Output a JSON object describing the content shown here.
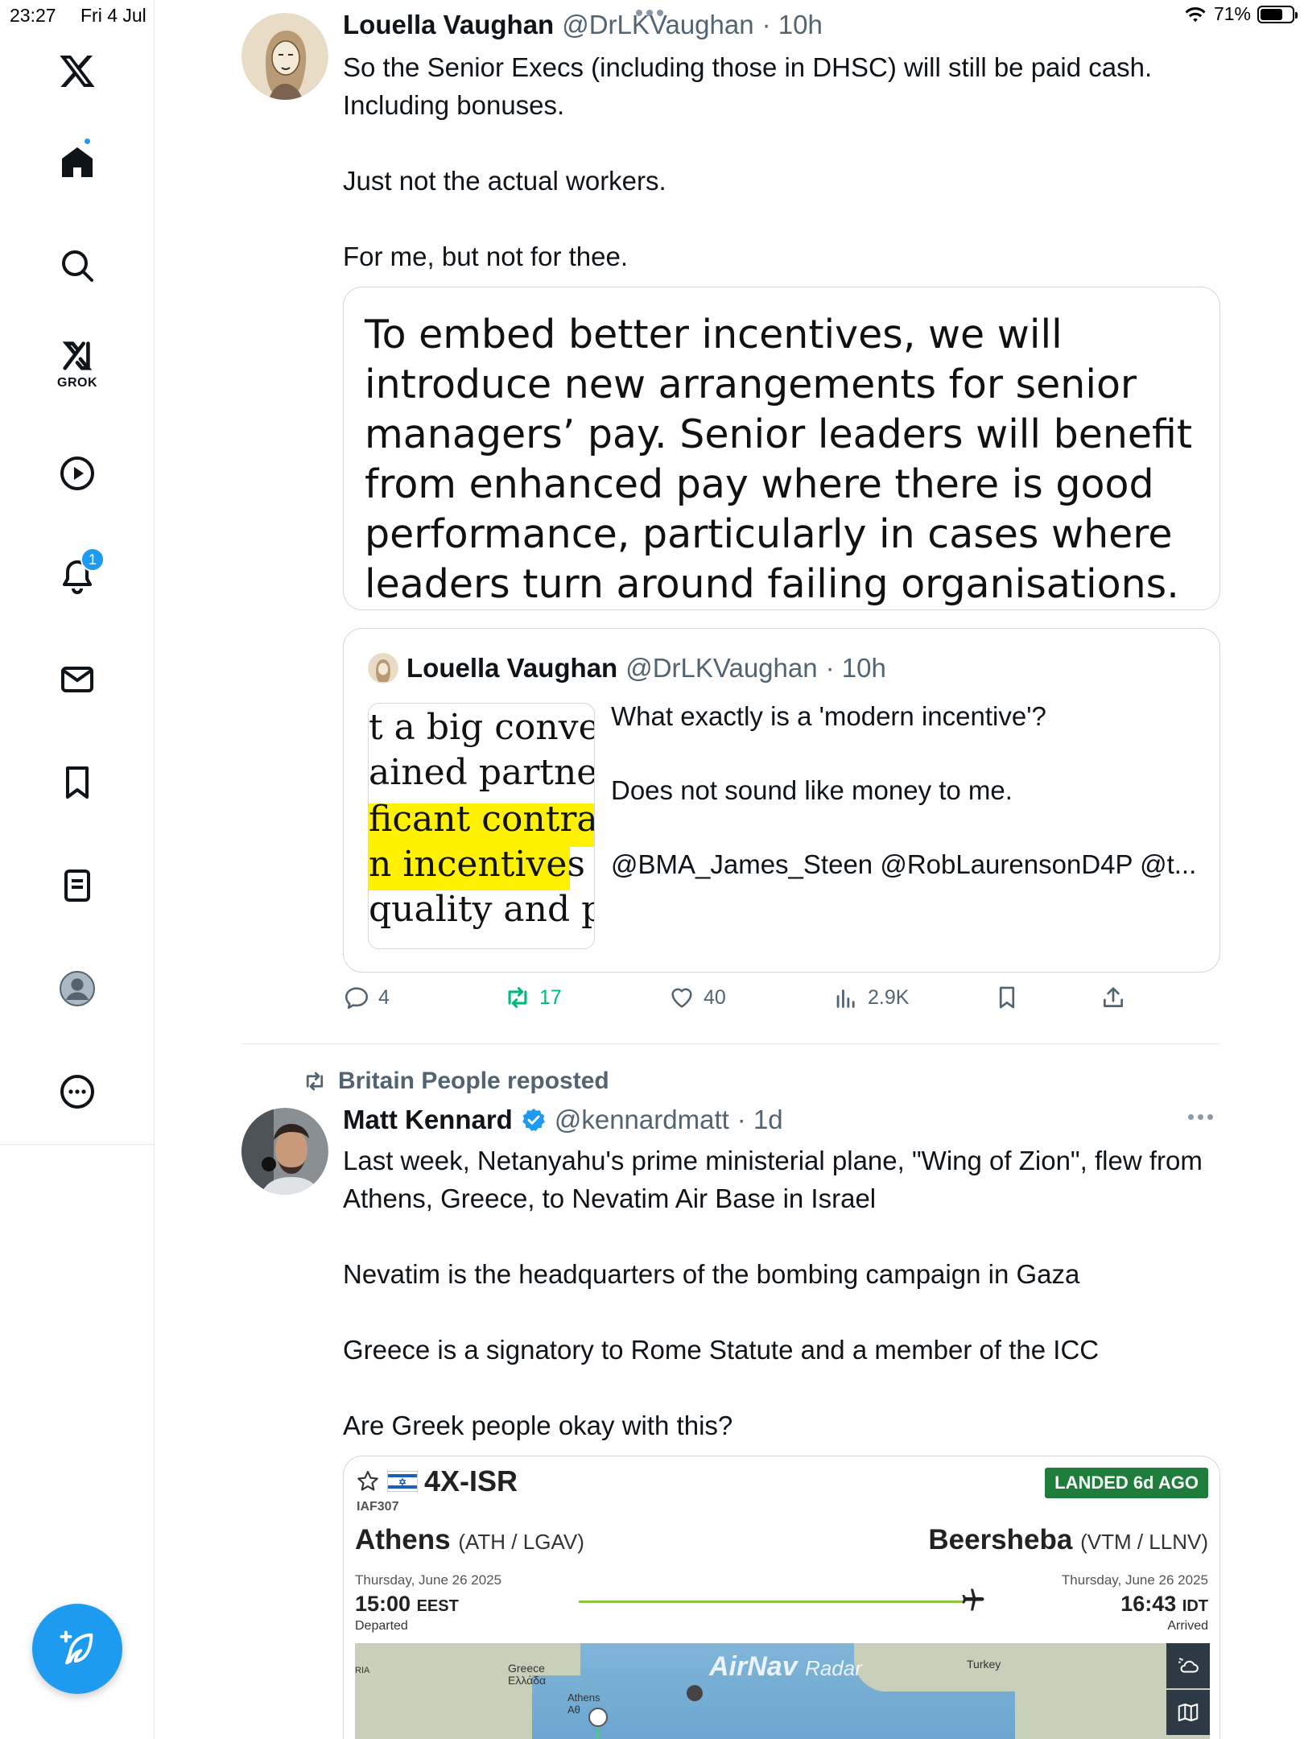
{
  "status_bar": {
    "time": "23:27",
    "date": "Fri 4 Jul",
    "battery": "71%",
    "battery_level": 0.71
  },
  "sidebar": {
    "grok_label": "GROK",
    "notification_count": "1",
    "icons": [
      "x-logo-icon",
      "home-icon",
      "search-icon",
      "grok-icon",
      "video-icon",
      "bell-icon",
      "mail-icon",
      "bookmark-icon",
      "list-icon",
      "profile-icon",
      "more-icon"
    ]
  },
  "tweet1": {
    "name": "Louella Vaughan",
    "handle": "@DrLKVaughan",
    "time": "· 10h",
    "text": "So the Senior Execs (including those in DHSC) will still be paid cash. Including bonuses.\n\nJust not the actual workers.\n\nFor me, but not for thee.",
    "image_text": "To embed better incentives, we will introduce new arrangements for senior managers’ pay. Senior leaders will benefit from enhanced pay where there is good performance, particularly in cases where leaders turn around failing organisations. Conversely,",
    "quoted": {
      "name": "Louella Vaughan",
      "handle": "@DrLKVaughan",
      "time": "· 10h",
      "thumb_lines": [
        "t a big convers",
        "ained partner",
        "ficant contract",
        "n incentives ar",
        "quality and pro"
      ],
      "text": "What exactly is a 'modern incentive'?\n\nDoes not sound like money to me.\n\n@BMA_James_Steen @RobLaurensonD4P @t..."
    },
    "stats": {
      "replies": "4",
      "reposts": "17",
      "likes": "40",
      "views": "2.9K"
    }
  },
  "tweet2": {
    "reposted_by": "Britain People reposted",
    "name": "Matt Kennard",
    "handle": "@kennardmatt",
    "time": "· 1d",
    "verified": true,
    "text": "Last week, Netanyahu's prime ministerial plane, \"Wing of Zion\", flew from Athens, Greece, to Nevatim Air Base in Israel\n\nNevatim is the headquarters of the bombing campaign in Gaza\n\nGreece is a signatory to Rome Statute and a member of the ICC\n\nAre Greek people okay with this?",
    "flight": {
      "registration": "4X-ISR",
      "flight_number": "IAF307",
      "status": "LANDED 6d AGO",
      "origin_city": "Athens",
      "origin_codes": "(ATH / LGAV)",
      "dest_city": "Beersheba",
      "dest_codes": "(VTM / LLNV)",
      "dep_date": "Thursday, June 26 2025",
      "arr_date": "Thursday, June 26 2025",
      "dep_time": "15:00",
      "dep_tz": "EEST",
      "arr_time": "16:43",
      "arr_tz": "IDT",
      "dep_status": "Departed",
      "arr_status": "Arrived",
      "map_brand": "AirNav",
      "map_brand_suffix": "Radar",
      "map_labels": [
        "Greece\nΕλλάδα",
        "Turkey",
        "Athens\nΑθ",
        "RIA"
      ]
    }
  },
  "colors": {
    "accent": "#1d9bf0",
    "repost_green": "#00ba7c",
    "muted_text": "#536471",
    "highlight_yellow": "#fff200",
    "landed_green": "#1e7d3a"
  }
}
